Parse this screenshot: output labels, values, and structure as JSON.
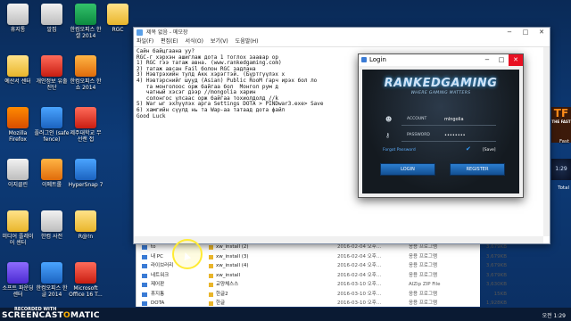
{
  "desktop_icons": [
    {
      "label": "휴지통",
      "col": 0,
      "row": 0
    },
    {
      "label": "알집",
      "col": 1,
      "row": 0
    },
    {
      "label": "한컴오피스 한셀 2014",
      "col": 2,
      "row": 0
    },
    {
      "label": "RGC",
      "col": 3,
      "row": 0
    },
    {
      "label": "예산서 센터",
      "col": 0,
      "row": 1
    },
    {
      "label": "개인정보 유출진단",
      "col": 1,
      "row": 1
    },
    {
      "label": "한컴오피스 한쇼 2014",
      "col": 2,
      "row": 1
    },
    {
      "label": "Mozilla Firefox",
      "col": 0,
      "row": 2
    },
    {
      "label": "플러그인 (safe fence)",
      "col": 1,
      "row": 2
    },
    {
      "label": "제주대학교 무선랜 접",
      "col": 2,
      "row": 2
    },
    {
      "label": "이지클린",
      "col": 0,
      "row": 3
    },
    {
      "label": "이메트롤",
      "col": 1,
      "row": 3
    },
    {
      "label": "HyperSnap 7",
      "col": 2,
      "row": 3
    },
    {
      "label": "미디어 플레이어 센터",
      "col": 0,
      "row": 4
    },
    {
      "label": "한컴 사전",
      "col": 1,
      "row": 4
    },
    {
      "label": "R@!n",
      "col": 2,
      "row": 4
    },
    {
      "label": "소프트 파운딩 센터",
      "col": 0,
      "row": 5
    },
    {
      "label": "한컴오피스 한글 2014",
      "col": 1,
      "row": 5
    },
    {
      "label": "Microsoft Office 16 T...",
      "col": 2,
      "row": 5
    }
  ],
  "notepad": {
    "title": "제목 없음 - 메모장",
    "menu": [
      "파일(F)",
      "편집(E)",
      "서식(O)",
      "보기(V)",
      "도움말(H)"
    ],
    "lines": [
      "Сайн байцгаана уу?",
      "RGC-г хэрхэн ашиглаж дота 1 тоглох заавар ор",
      "1) RGC гээ татаж авна. (www.rankedgaming.com)",
      "2) татаж авсан Fail болон RGC задлана",
      "3) Нэвтрэхийн тулд Акк хэрэгтэй. (Бүртгүүлэх х",
      "4) Нэвтэрснийг шууд (Asian) Public RooM гарч ирэх бол ло",
      "   та монголоос орж байгаа бол  Монгол рум д",
      "   чатный хэсэг дээр //mongolia харин",
      "   солонгос улсаас орж байгаа тохиолдолд //k",
      "5) War ыг эхлүүлэх арга Settings DOTA > PINDwar3.exe> Save",
      "6) хамгийн сүүлд нь та Wap-аа татаад дота файл",
      "Good Luck"
    ]
  },
  "login": {
    "title": "Login",
    "logo": "RANKEDGAMING",
    "tagline": "WHERE GAMING MATTERS",
    "account_label": "ACCOUNT",
    "account_value": "mlngolia",
    "password_label": "PASSWORD",
    "password_value": "••••••••",
    "forgot": "Forgot Password",
    "save": "[Save]",
    "login_button": "LOGIN",
    "register_button": "REGISTER"
  },
  "explorer": {
    "nav": [
      "to",
      "내 PC",
      "라이브러리",
      "네트워크",
      "제어판",
      "휴지통",
      "DOTA"
    ],
    "files": [
      {
        "name": "xw_install (2)",
        "date": "2016-02-04 오후...",
        "type": "응용 프로그램",
        "size": "3,679KB"
      },
      {
        "name": "xw_install (3)",
        "date": "2016-02-04 오후...",
        "type": "응용 프로그램",
        "size": "3,679KB"
      },
      {
        "name": "xw_install (4)",
        "date": "2016-02-04 오후...",
        "type": "응용 프로그램",
        "size": "3,679KB"
      },
      {
        "name": "xw_install",
        "date": "2016-02-04 오후...",
        "type": "응용 프로그램",
        "size": "3,679KB"
      },
      {
        "name": "교양체스스",
        "date": "2016-03-10 오후...",
        "type": "AlZip ZIP File",
        "size": "3,630KB"
      },
      {
        "name": "한글2",
        "date": "2016-03-10 오후...",
        "type": "응용 프로그램",
        "size": "15KB"
      },
      {
        "name": "한글",
        "date": "2016-03-10 오후...",
        "type": "응용 프로그램",
        "size": "1,928KB"
      }
    ]
  },
  "taskbar": {
    "clock": "오전 1:29"
  },
  "watermark": {
    "text": "SCREENCAST",
    "mid": "O",
    "end": "MATIC",
    "rec": "RECORDED WITH"
  },
  "right_side": {
    "promo": "TF",
    "promo_sub": "THE FAST",
    "label1": "Fast",
    "app": "1:29",
    "label2": "Total"
  }
}
